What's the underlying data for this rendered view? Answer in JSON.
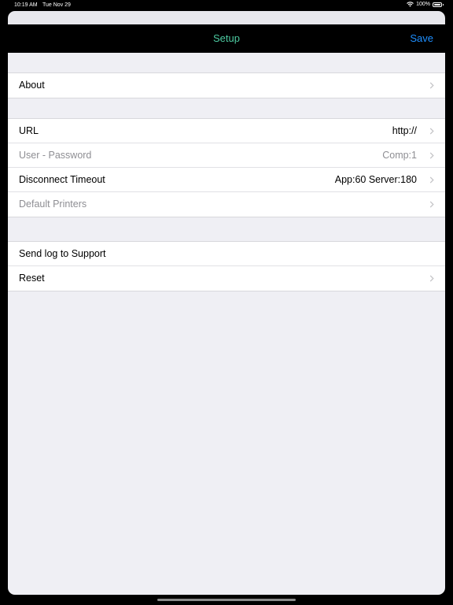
{
  "status_bar": {
    "time": "10:19 AM",
    "date": "Tue Nov 29",
    "battery": "100%",
    "wifi_icon": "wifi-icon",
    "battery_icon": "battery-icon"
  },
  "nav": {
    "title": "Setup",
    "save_label": "Save",
    "title_color": "#4cc9a0",
    "save_color": "#1e8fff"
  },
  "groups": [
    {
      "rows": [
        {
          "label": "About",
          "value": "",
          "enabled": true,
          "chevron": true
        }
      ]
    },
    {
      "rows": [
        {
          "label": "URL",
          "value": "http://",
          "enabled": true,
          "chevron": true
        },
        {
          "label": "User - Password",
          "value": "Comp:1",
          "enabled": false,
          "chevron": true
        },
        {
          "label": "Disconnect Timeout",
          "value": "App:60 Server:180",
          "enabled": true,
          "chevron": true
        },
        {
          "label": "Default Printers",
          "value": "",
          "enabled": false,
          "chevron": true
        }
      ]
    },
    {
      "rows": [
        {
          "label": "Send log to Support",
          "value": "",
          "enabled": true,
          "chevron": false
        },
        {
          "label": "Reset",
          "value": "",
          "enabled": true,
          "chevron": true
        }
      ]
    }
  ]
}
